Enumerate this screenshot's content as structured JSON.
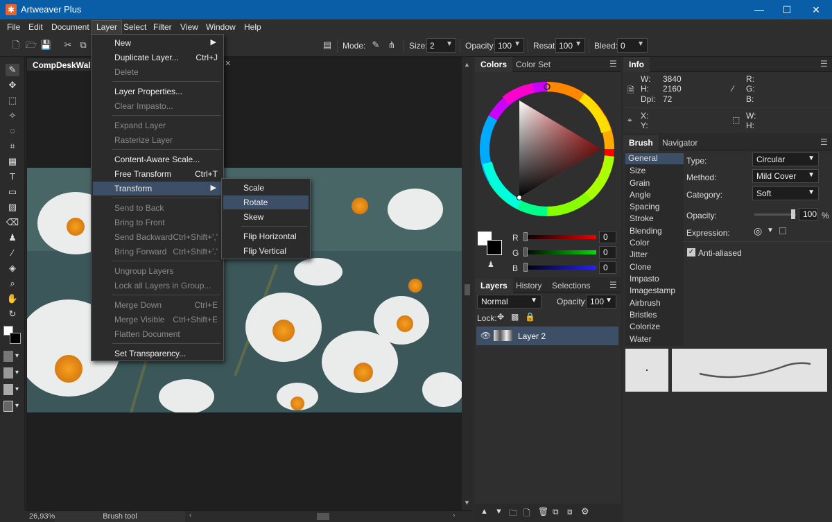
{
  "app": {
    "title": "Artweaver Plus"
  },
  "menubar": {
    "items": [
      "File",
      "Edit",
      "Document",
      "Layer",
      "Select",
      "Filter",
      "View",
      "Window",
      "Help"
    ]
  },
  "toolbar": {
    "mode_label": "Mode:",
    "size_label": "Size:",
    "size_value": "2",
    "opacity_label": "Opacity:",
    "opacity_value": "100",
    "resat_label": "Resat:",
    "resat_value": "100",
    "bleed_label": "Bleed:",
    "bleed_value": "0"
  },
  "document": {
    "tab": "CompDeskWalCo",
    "zoom": "26,93%",
    "tool": "Brush tool"
  },
  "layer_menu": {
    "new": "New",
    "duplicate": "Duplicate Layer...",
    "duplicate_sc": "Ctrl+J",
    "delete": "Delete",
    "properties": "Layer Properties...",
    "clear_impasto": "Clear Impasto...",
    "expand": "Expand Layer",
    "rasterize": "Rasterize Layer",
    "content_aware": "Content-Aware Scale...",
    "free_transform": "Free Transform",
    "free_transform_sc": "Ctrl+T",
    "transform": "Transform",
    "send_back": "Send to Back",
    "bring_front": "Bring to Front",
    "send_backward": "Send Backward",
    "send_backward_sc": "Ctrl+Shift+','",
    "bring_forward": "Bring Forward",
    "bring_forward_sc": "Ctrl+Shift+'.'",
    "ungroup": "Ungroup Layers",
    "lock_all": "Lock all Layers in Group...",
    "merge_down": "Merge Down",
    "merge_down_sc": "Ctrl+E",
    "merge_visible": "Merge Visible",
    "merge_visible_sc": "Ctrl+Shift+E",
    "flatten": "Flatten Document",
    "set_transparency": "Set Transparency..."
  },
  "transform_menu": {
    "scale": "Scale",
    "rotate": "Rotate",
    "skew": "Skew",
    "flip_h": "Flip Horizontal",
    "flip_v": "Flip Vertical"
  },
  "colors": {
    "tab1": "Colors",
    "tab2": "Color Set",
    "r_label": "R",
    "g_label": "G",
    "b_label": "B",
    "r": "0",
    "g": "0",
    "b": "0"
  },
  "layers": {
    "tab1": "Layers",
    "tab2": "History",
    "tab3": "Selections",
    "blend": "Normal",
    "opacity_label": "Opacity:",
    "opacity": "100",
    "lock_label": "Lock:",
    "layer_name": "Layer 2"
  },
  "info": {
    "tab": "Info",
    "w_label": "W:",
    "w": "3840",
    "h_label": "H:",
    "h": "2160",
    "dpi_label": "Dpi:",
    "dpi": "72",
    "r_label": "R:",
    "g_label": "G:",
    "b_label": "B:",
    "x_label": "X:",
    "y_label": "Y:",
    "w2_label": "W:",
    "h2_label": "H:"
  },
  "brush": {
    "tab1": "Brush",
    "tab2": "Navigator",
    "list": [
      "General",
      "Size",
      "Grain",
      "Angle",
      "Spacing",
      "Stroke",
      "Blending",
      "Color",
      "Jitter",
      "Clone",
      "Impasto",
      "Imagestamp",
      "Airbrush",
      "Bristles",
      "Colorize",
      "Water"
    ],
    "type_label": "Type:",
    "type": "Circular",
    "method_label": "Method:",
    "method": "Mild Cover",
    "category_label": "Category:",
    "category": "Soft",
    "opacity_label": "Opacity:",
    "opacity": "100",
    "opacity_unit": "%",
    "expression_label": "Expression:",
    "antialiased": "Anti-aliased"
  }
}
